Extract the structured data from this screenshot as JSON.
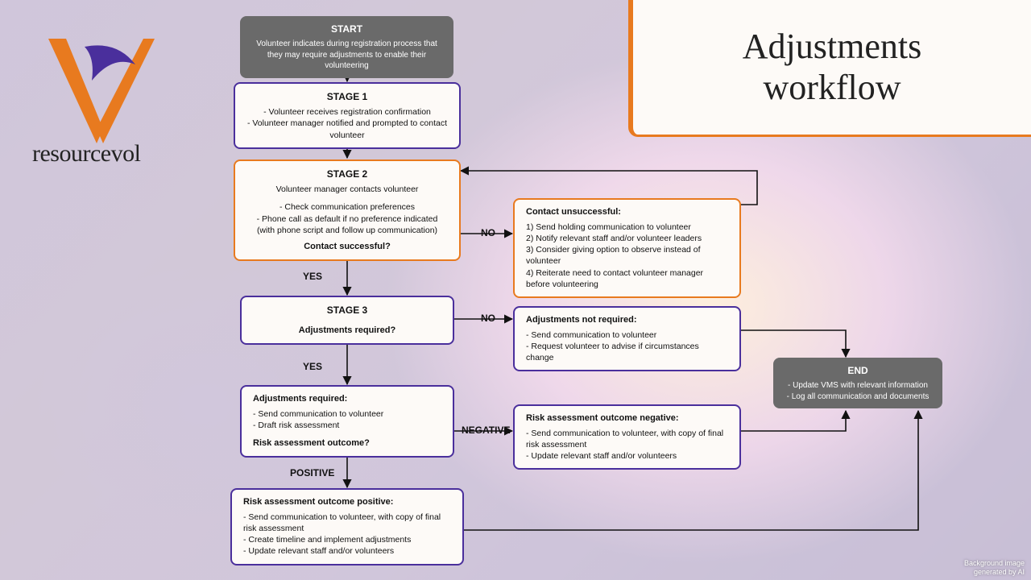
{
  "page": {
    "title_line1": "Adjustments",
    "title_line2": "workflow",
    "brand": "resourcevol",
    "credit_line1": "Background image",
    "credit_line2": "generated by AI"
  },
  "nodes": {
    "start": {
      "heading": "START",
      "body": "Volunteer indicates during registration process that they may require adjustments to enable their volunteering"
    },
    "stage1": {
      "heading": "STAGE 1",
      "line1": "- Volunteer receives registration confirmation",
      "line2": "- Volunteer manager notified and prompted to contact volunteer"
    },
    "stage2": {
      "heading": "STAGE 2",
      "sub": "Volunteer manager contacts volunteer",
      "line1": "- Check communication preferences",
      "line2": "- Phone call as default if no preference indicated",
      "line3": "(with phone script and follow up communication)",
      "question": "Contact successful?"
    },
    "contact_fail": {
      "heading": "Contact unsuccessful:",
      "line1": "1) Send holding communication to volunteer",
      "line2": "2) Notify relevant staff and/or volunteer leaders",
      "line3": "3) Consider giving option to observe instead of volunteer",
      "line4": "4) Reiterate need to contact volunteer manager before volunteering"
    },
    "stage3": {
      "heading": "STAGE 3",
      "question": "Adjustments required?"
    },
    "adj_not_req": {
      "heading": "Adjustments not required:",
      "line1": "- Send communication to volunteer",
      "line2": "- Request volunteer to advise if circumstances change"
    },
    "adj_req": {
      "heading": "Adjustments required:",
      "line1": "- Send communication to volunteer",
      "line2": "- Draft risk assessment",
      "question": "Risk assessment outcome?"
    },
    "risk_neg": {
      "heading": "Risk assessment outcome negative:",
      "line1": "- Send communication to volunteer, with copy of final risk assessment",
      "line2": "- Update relevant staff and/or volunteers"
    },
    "risk_pos": {
      "heading": "Risk assessment outcome positive:",
      "line1": "- Send communication to volunteer, with copy of final risk assessment",
      "line2": "- Create timeline and implement adjustments",
      "line3": "- Update relevant staff and/or volunteers"
    },
    "end": {
      "heading": "END",
      "line1": "- Update VMS with relevant information",
      "line2": "- Log all communication and documents"
    }
  },
  "labels": {
    "no": "NO",
    "yes": "YES",
    "negative": "NEGATIVE",
    "positive": "POSITIVE"
  },
  "colors": {
    "purple": "#4a2f9c",
    "orange": "#e87a1f",
    "dark": "#6a6a6a"
  }
}
